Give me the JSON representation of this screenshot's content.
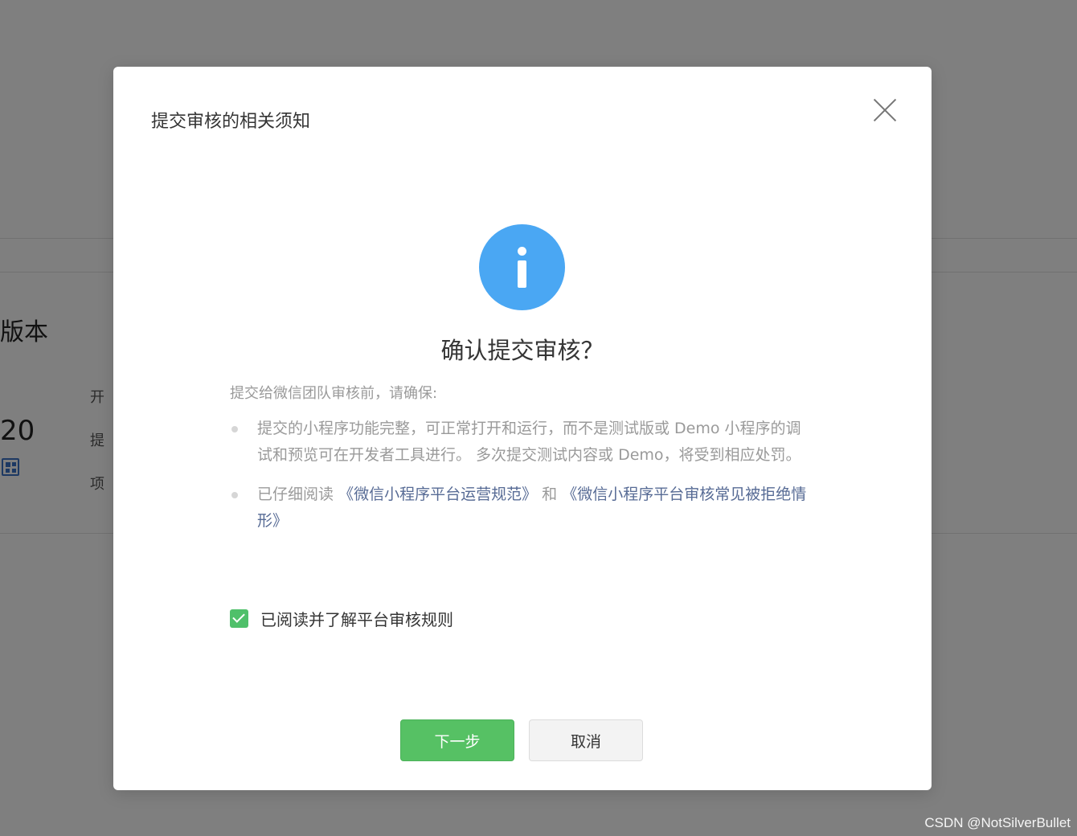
{
  "background": {
    "title_fragment": "版本",
    "version_fragment": "20",
    "labels": [
      "开",
      "提",
      "项"
    ]
  },
  "dialog": {
    "title": "提交审核的相关须知",
    "confirm_title": "确认提交审核？",
    "intro": "提交给微信团队审核前，请确保:",
    "note1": "提交的小程序功能完整，可正常打开和运行，而不是测试版或 Demo 小程序的调试和预览可在开发者工具进行。 多次提交测试内容或 Demo，将受到相应处罚。",
    "note2_prefix": "已仔细阅读",
    "note2_link1": "《微信小程序平台运营规范》",
    "note2_and": "和",
    "note2_link2": "《微信小程序平台审核常见被拒绝情形》",
    "agree_label": "已阅读并了解平台审核规则",
    "agree_checked": true,
    "next_label": "下一步",
    "cancel_label": "取消"
  },
  "watermark": "CSDN @NotSilverBullet",
  "colors": {
    "primary": "#56c164",
    "info": "#4aa7f3",
    "link": "#576b95"
  }
}
